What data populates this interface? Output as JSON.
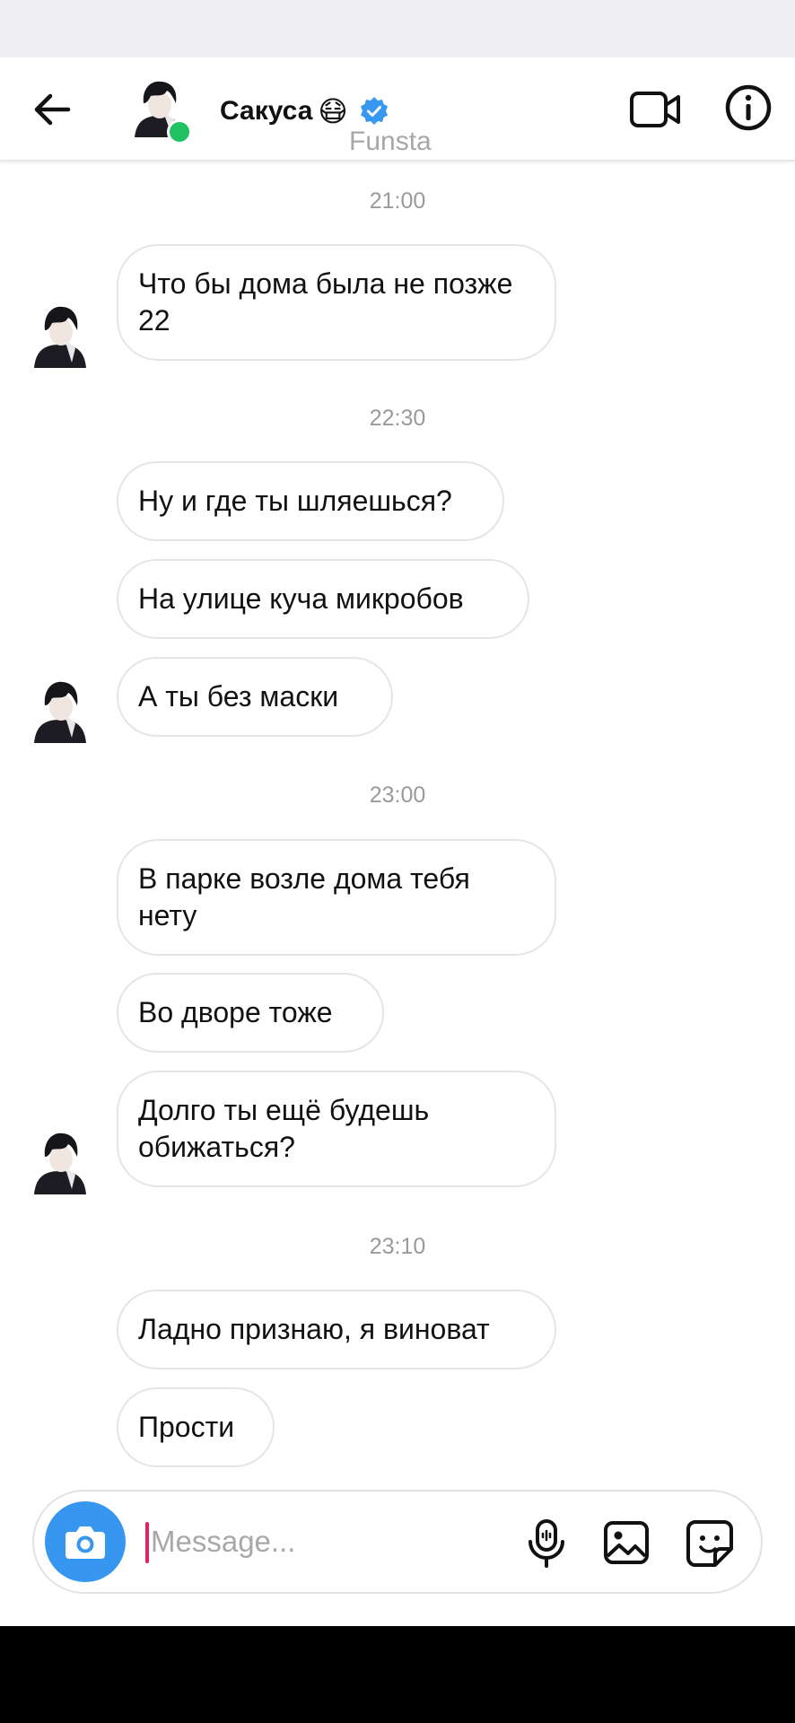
{
  "header": {
    "contact_name": "Сакуса",
    "name_emoji": "😷",
    "subtitle": "Funsta",
    "online_status_color": "#1fc260",
    "verified_color": "#3897f0",
    "icons": {
      "back": "arrow-left-icon",
      "video": "video-camera-icon",
      "info": "info-icon"
    }
  },
  "messages": [
    {
      "timestamp": "21:00",
      "bubbles": [
        "Что бы дома была не позже 22"
      ]
    },
    {
      "timestamp": "22:30",
      "bubbles": [
        "Ну и где ты шляешься?",
        "На улице куча микробов",
        "А ты без маски"
      ]
    },
    {
      "timestamp": "23:00",
      "bubbles": [
        "В парке возле дома тебя нету",
        "Во дворе тоже",
        "Долго ты ещё будешь обижаться?"
      ]
    },
    {
      "timestamp": "23:10",
      "bubbles": [
        "Ладно признаю, я виноват",
        "Прости"
      ]
    }
  ],
  "composer": {
    "placeholder": "Message...",
    "value": "",
    "camera_color": "#3797f0",
    "icons": {
      "camera": "camera-icon",
      "mic": "microphone-icon",
      "gallery": "image-gallery-icon",
      "sticker": "sticker-icon"
    }
  }
}
